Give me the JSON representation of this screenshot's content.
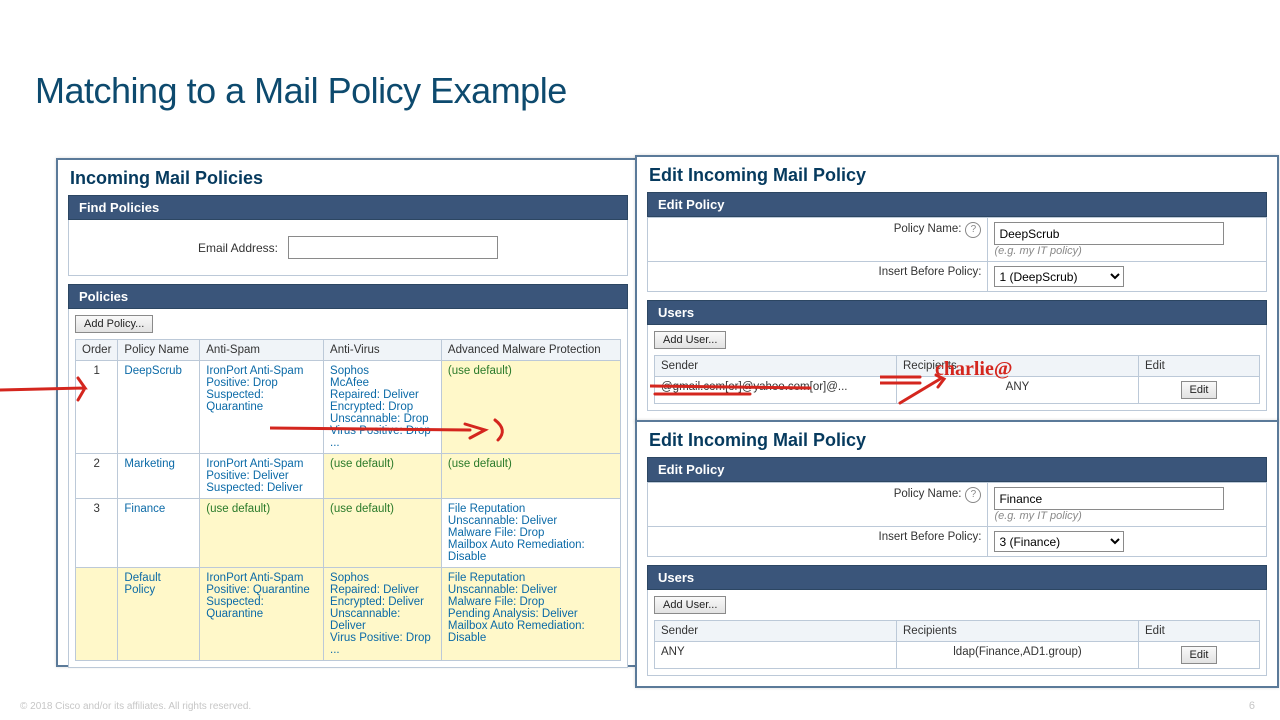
{
  "title": "Matching to a Mail Policy Example",
  "footer": "© 2018 Cisco and/or its affiliates. All rights reserved.",
  "page_number": "6",
  "left_panel": {
    "heading": "Incoming Mail Policies",
    "find_bar": "Find Policies",
    "email_label": "Email Address:",
    "policies_bar": "Policies",
    "add_policy": "Add Policy...",
    "columns": [
      "Order",
      "Policy Name",
      "Anti-Spam",
      "Anti-Virus",
      "Advanced Malware Protection"
    ],
    "rows": [
      {
        "order": "1",
        "name": "DeepScrub",
        "antispam": "IronPort Anti-Spam\nPositive: Drop\nSuspected: Quarantine",
        "antivirus": "Sophos\nMcAfee\nRepaired: Deliver\nEncrypted: Drop\nUnscannable: Drop\nVirus Positive: Drop\n...",
        "amp": "(use default)",
        "yellowCells": [
          "amp"
        ]
      },
      {
        "order": "2",
        "name": "Marketing",
        "antispam": "IronPort Anti-Spam\nPositive: Deliver\nSuspected: Deliver",
        "antivirus": "(use default)",
        "amp": "(use default)",
        "yellowCells": [
          "antivirus",
          "amp"
        ]
      },
      {
        "order": "3",
        "name": "Finance",
        "antispam": "(use default)",
        "antivirus": "(use default)",
        "amp": "File Reputation\nUnscannable: Deliver\nMalware File: Drop\nMailbox Auto Remediation: Disable",
        "yellowCells": [
          "antispam",
          "antivirus"
        ]
      },
      {
        "order": "",
        "name": "Default Policy",
        "antispam": "IronPort Anti-Spam\nPositive: Quarantine\nSuspected: Quarantine",
        "antivirus": "Sophos\nRepaired: Deliver\nEncrypted: Deliver\nUnscannable: Deliver\nVirus Positive: Drop\n...",
        "amp": "File Reputation\nUnscannable: Deliver\nMalware File: Drop\nPending Analysis: Deliver\nMailbox Auto Remediation: Disable",
        "yellowRow": true
      }
    ]
  },
  "top_right": {
    "heading": "Edit Incoming Mail Policy",
    "edit_bar": "Edit Policy",
    "name_label": "Policy Name:",
    "name_value": "DeepScrub",
    "name_hint": "(e.g. my IT policy)",
    "insert_label": "Insert Before Policy:",
    "insert_value": "1 (DeepScrub)",
    "users_bar": "Users",
    "add_user": "Add User...",
    "users_cols": [
      "Sender",
      "Recipients",
      "Edit"
    ],
    "sender": "@gmail.com[or]@yahoo.com[or]@...",
    "recipients": "ANY",
    "edit": "Edit"
  },
  "bottom_right": {
    "heading": "Edit Incoming Mail Policy",
    "edit_bar": "Edit Policy",
    "name_label": "Policy Name:",
    "name_value": "Finance",
    "name_hint": "(e.g. my IT policy)",
    "insert_label": "Insert Before Policy:",
    "insert_value": "3 (Finance)",
    "users_bar": "Users",
    "add_user": "Add User...",
    "users_cols": [
      "Sender",
      "Recipients",
      "Edit"
    ],
    "sender": "ANY",
    "recipients": "ldap(Finance,AD1.group)",
    "edit": "Edit"
  },
  "annotation_text": "charlie@"
}
